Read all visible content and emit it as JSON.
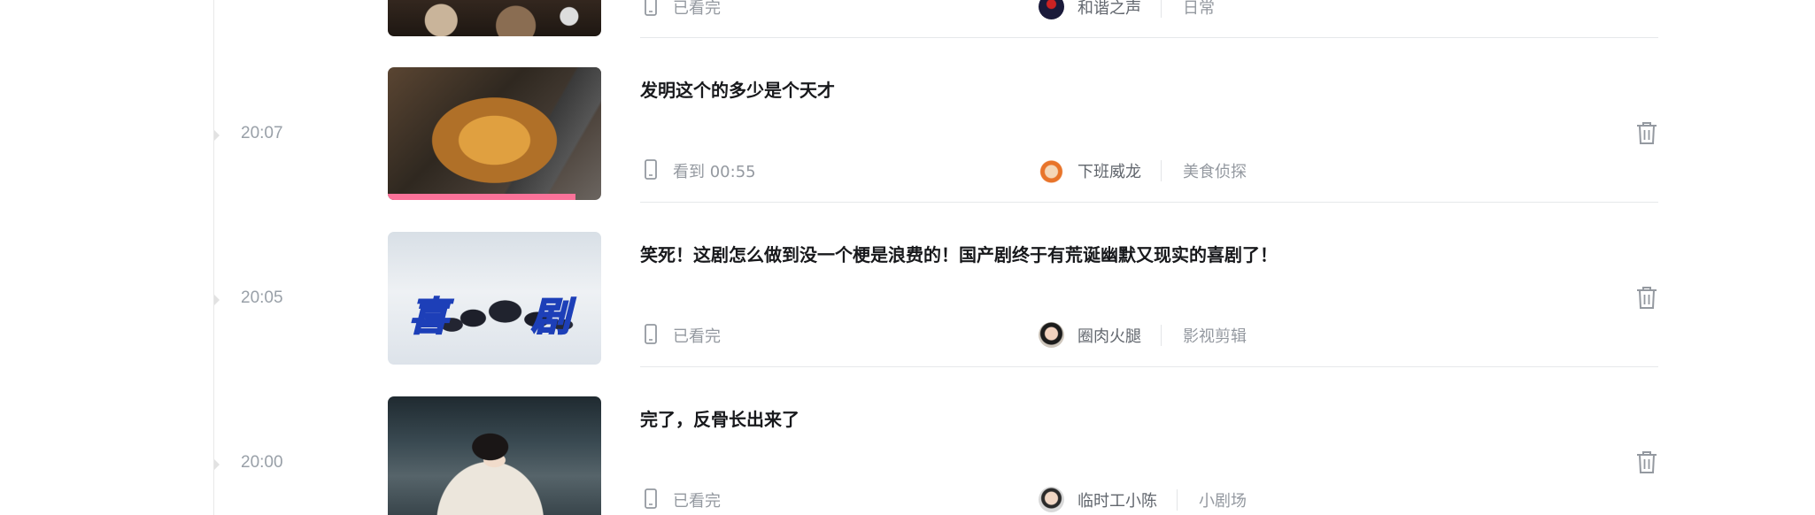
{
  "entries": [
    {
      "time": "",
      "title": "",
      "status": "已看完",
      "uploader": "和谐之声",
      "category": "日常",
      "progress": null
    },
    {
      "time": "20:07",
      "title": "发明这个的多少是个天才",
      "status": "看到 00:55",
      "uploader": "下班威龙",
      "category": "美食侦探",
      "progress": 0.88
    },
    {
      "time": "20:05",
      "title": "笑死！这剧怎么做到没一个梗是浪费的！国产剧终于有荒诞幽默又现实的喜剧了！",
      "status": "已看完",
      "uploader": "圈肉火腿",
      "category": "影视剪辑",
      "progress": null,
      "thumb_overlay": [
        "喜",
        "剧"
      ]
    },
    {
      "time": "20:00",
      "title": "完了，反骨长出来了",
      "status": "已看完",
      "uploader": "临时工小陈",
      "category": "小剧场",
      "progress": null
    }
  ],
  "colors": {
    "progress": "#fb7299",
    "title": "#18191c",
    "muted": "#9499a0"
  },
  "icons": {
    "device": "mobile-phone-icon",
    "delete": "trash-icon"
  }
}
